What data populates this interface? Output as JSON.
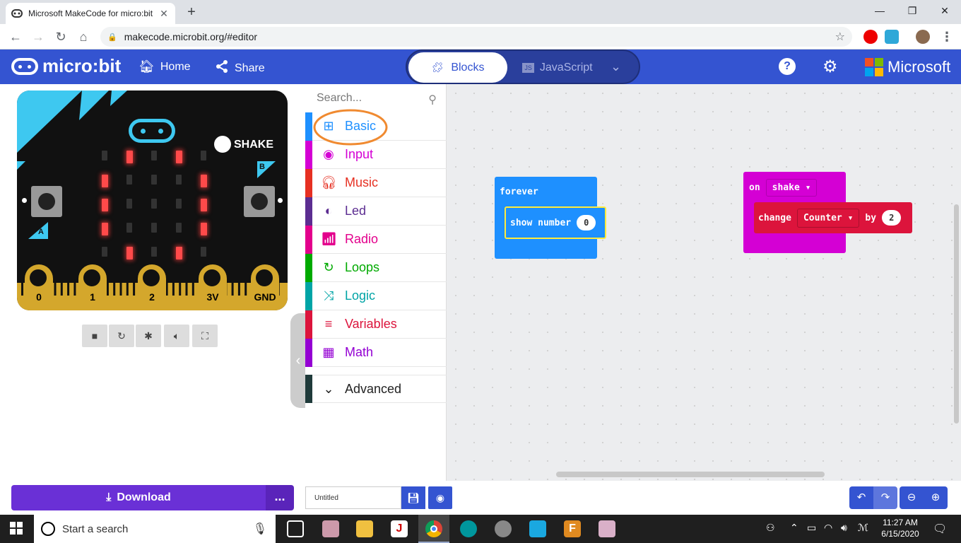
{
  "browser": {
    "tab_title": "Microsoft MakeCode for micro:bit",
    "url": "makecode.microbit.org/#editor"
  },
  "header": {
    "logo": "micro:bit",
    "home_label": "Home",
    "share_label": "Share",
    "blocks_label": "Blocks",
    "javascript_label": "JavaScript",
    "microsoft_label": "Microsoft"
  },
  "simulator": {
    "shake_label": "SHAKE",
    "button_a": "A",
    "button_b": "B",
    "pins": [
      "0",
      "1",
      "2",
      "3V",
      "GND"
    ]
  },
  "toolbox": {
    "search_placeholder": "Search...",
    "categories": [
      {
        "label": "Basic",
        "color": "#1e90ff"
      },
      {
        "label": "Input",
        "color": "#d400d4"
      },
      {
        "label": "Music",
        "color": "#e63022"
      },
      {
        "label": "Led",
        "color": "#5c2d91"
      },
      {
        "label": "Radio",
        "color": "#e3008c"
      },
      {
        "label": "Loops",
        "color": "#00aa00"
      },
      {
        "label": "Logic",
        "color": "#00a4a6"
      },
      {
        "label": "Variables",
        "color": "#dc143c"
      },
      {
        "label": "Math",
        "color": "#9400d3"
      }
    ],
    "advanced_label": "Advanced"
  },
  "workspace": {
    "forever_block": {
      "label": "forever",
      "inner": "show number",
      "value": "0"
    },
    "shake_block": {
      "on": "on",
      "event": "shake",
      "action": "change",
      "variable": "Counter",
      "by": "by",
      "value": "2"
    }
  },
  "bottom": {
    "download_label": "Download",
    "more_label": "...",
    "project_name": "Untitled"
  },
  "taskbar": {
    "search_text": "Start a search",
    "time": "11:27 AM",
    "date": "6/15/2020"
  }
}
